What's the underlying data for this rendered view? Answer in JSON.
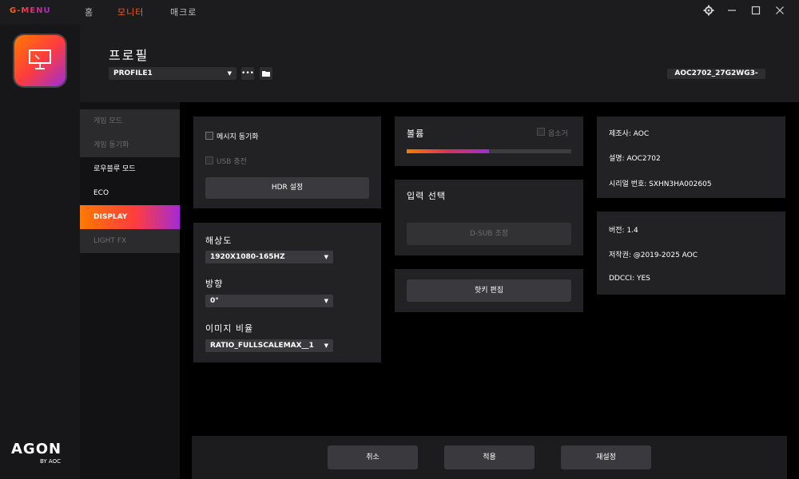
{
  "app": {
    "logo": "G-MENU"
  },
  "nav": {
    "tabs": [
      "홈",
      "모니터",
      "매크로"
    ],
    "active_tab": "모니터"
  },
  "window": {
    "settings_icon": "gear-icon",
    "minimize_icon": "minimize-icon",
    "maximize_icon": "maximize-icon",
    "close_icon": "close-icon"
  },
  "brand": {
    "name": "AGON",
    "by": "BY AOC"
  },
  "header": {
    "title": "프로필",
    "profile_value": "PROFILE1",
    "more_icon": "more-icon",
    "folder_icon": "folder-icon",
    "monitor_id": "AOC2702_27G2WG3-"
  },
  "sidebar": {
    "items": [
      {
        "label": "게임 모드",
        "state": "disabled"
      },
      {
        "label": "게임 동기화",
        "state": "disabled"
      },
      {
        "label": "로우블루 모드",
        "state": "normal"
      },
      {
        "label": "ECO",
        "state": "normal"
      },
      {
        "label": "DISPLAY",
        "state": "active"
      },
      {
        "label": "LIGHT FX",
        "state": "disabled"
      }
    ]
  },
  "sync_card": {
    "message_sync": "메시지 동기화",
    "usb_charge": "USB 충전",
    "hdr_button": "HDR 설정"
  },
  "display_card": {
    "resolution_label": "해상도",
    "resolution_value": "1920X1080-165HZ",
    "direction_label": "방향",
    "direction_value": "0°",
    "aspect_label": "이미지 비율",
    "aspect_value": "RATIO_FULLSCALEMAX__1"
  },
  "volume_card": {
    "title": "볼륨",
    "mute_label": "음소거",
    "level_percent": 50
  },
  "input_card": {
    "title": "입력 선택",
    "dsub_button": "D-SUB 조정"
  },
  "hotkey_card": {
    "button": "핫키 편집"
  },
  "info_card": {
    "manufacturer": "제조사: AOC",
    "description": "설명: AOC2702",
    "serial": "시리얼 번호: SXHN3HA002605"
  },
  "version_card": {
    "version": "버전: 1.4",
    "copyright": "저작권: @2019-2025 AOC",
    "ddcci": "DDCCI: YES"
  },
  "footer": {
    "cancel": "취소",
    "apply": "적용",
    "reset": "재설정"
  }
}
